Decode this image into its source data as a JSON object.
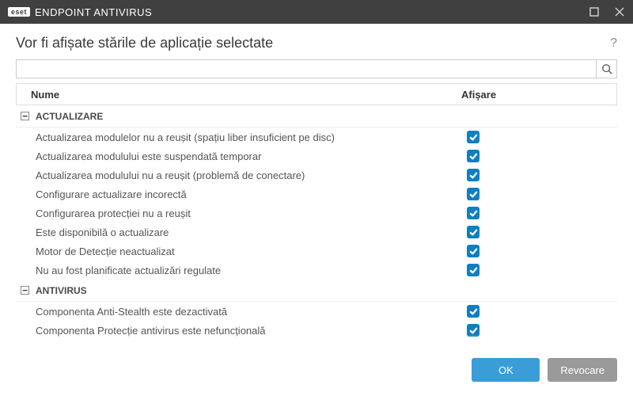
{
  "brand_badge": "eset",
  "app_title": "ENDPOINT ANTIVIRUS",
  "page_title": "Vor fi afișate stările de aplicație selectate",
  "search": {
    "placeholder": ""
  },
  "columns": {
    "name": "Nume",
    "show": "Afișare"
  },
  "collapse_glyph": "−",
  "groups": [
    {
      "label": "ACTUALIZARE",
      "items": [
        {
          "label": "Actualizarea modulelor nu a reușit (spațiu liber insuficient pe disc)",
          "checked": true
        },
        {
          "label": "Actualizarea modulului este suspendată temporar",
          "checked": true
        },
        {
          "label": "Actualizarea modulului nu a reușit (problemă de conectare)",
          "checked": true
        },
        {
          "label": "Configurare actualizare incorectă",
          "checked": true
        },
        {
          "label": "Configurarea protecției nu a reușit",
          "checked": true
        },
        {
          "label": "Este disponibilă o actualizare",
          "checked": true
        },
        {
          "label": "Motor de Detecție neactualizat",
          "checked": true
        },
        {
          "label": "Nu au fost planificate actualizări regulate",
          "checked": true
        }
      ]
    },
    {
      "label": "ANTIVIRUS",
      "items": [
        {
          "label": "Componenta Anti-Stealth este dezactivată",
          "checked": true
        },
        {
          "label": "Componenta Protecție antivirus este nefuncțională",
          "checked": true
        }
      ]
    }
  ],
  "buttons": {
    "ok": "OK",
    "cancel": "Revocare"
  }
}
